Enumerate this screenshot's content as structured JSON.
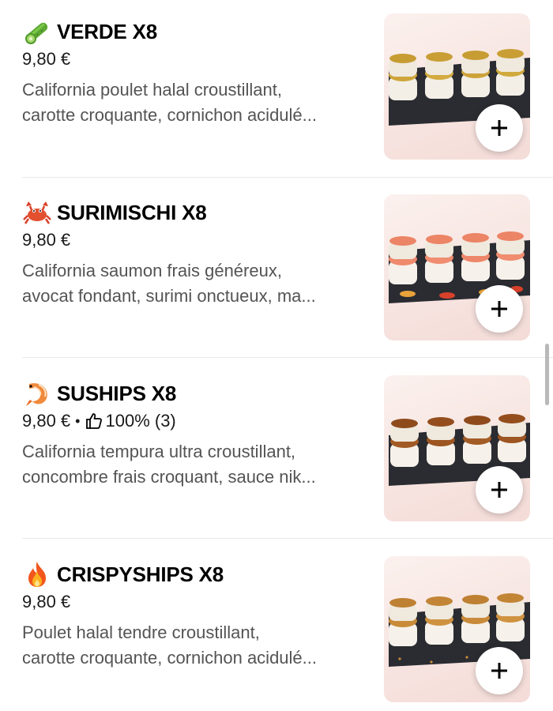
{
  "items": [
    {
      "emoji": "cucumber-icon",
      "name": "VERDE X8",
      "price": "9,80 €",
      "rating": "",
      "description_line1": "California poulet halal croustillant,",
      "description_line2": "carotte croquante, cornichon acidulé..."
    },
    {
      "emoji": "crab-icon",
      "name": "SURIMISCHI X8",
      "price": "9,80 €",
      "rating": "",
      "description_line1": "California saumon frais généreux,",
      "description_line2": "avocat fondant, surimi onctueux, ma..."
    },
    {
      "emoji": "shrimp-icon",
      "name": "SUSHIPS X8",
      "price": "9,80 €",
      "rating": "100% (3)",
      "description_line1": "California tempura ultra croustillant,",
      "description_line2": "concombre frais croquant, sauce nik..."
    },
    {
      "emoji": "fire-icon",
      "name": "CRISPYSHIPS X8",
      "price": "9,80 €",
      "rating": "",
      "description_line1": "Poulet halal tendre croustillant,",
      "description_line2": "carotte croquante, cornichon acidulé..."
    }
  ],
  "add_label": "+",
  "meta_separator": "•"
}
